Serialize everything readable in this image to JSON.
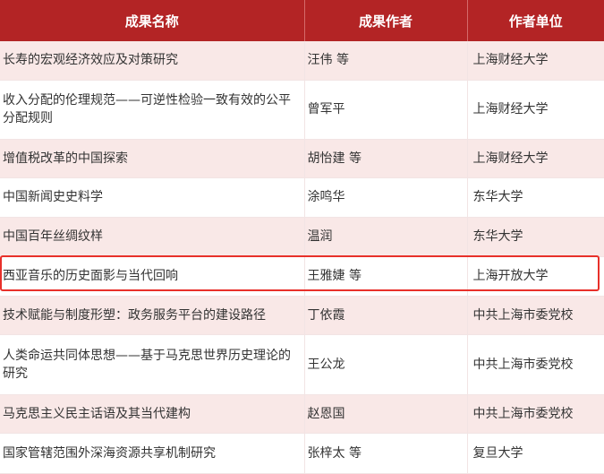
{
  "headers": {
    "name": "成果名称",
    "author": "成果作者",
    "org": "作者单位"
  },
  "rows": [
    {
      "name": "长寿的宏观经济效应及对策研究",
      "author": "汪伟 等",
      "org": "上海财经大学"
    },
    {
      "name": "收入分配的伦理规范——可逆性检验一致有效的公平分配规则",
      "author": "曾军平",
      "org": "上海财经大学"
    },
    {
      "name": "增值税改革的中国探索",
      "author": "胡怡建 等",
      "org": "上海财经大学"
    },
    {
      "name": "中国新闻史史料学",
      "author": "涂鸣华",
      "org": "东华大学"
    },
    {
      "name": "中国百年丝绸纹样",
      "author": "温润",
      "org": "东华大学"
    },
    {
      "name": "西亚音乐的历史面影与当代回响",
      "author": "王雅婕 等",
      "org": "上海开放大学"
    },
    {
      "name": "技术赋能与制度形塑：政务服务平台的建设路径",
      "author": "丁依霞",
      "org": "中共上海市委党校"
    },
    {
      "name": "人类命运共同体思想——基于马克思世界历史理论的研究",
      "author": "王公龙",
      "org": "中共上海市委党校"
    },
    {
      "name": "马克思主义民主话语及其当代建构",
      "author": "赵恩国",
      "org": "中共上海市委党校"
    },
    {
      "name": "国家管辖范围外深海资源共享机制研究",
      "author": "张梓太 等",
      "org": "复旦大学"
    }
  ],
  "colors": {
    "header_bg": "#b32425",
    "stripe_bg": "#f9e8e7",
    "highlight_border": "#e8302a"
  }
}
